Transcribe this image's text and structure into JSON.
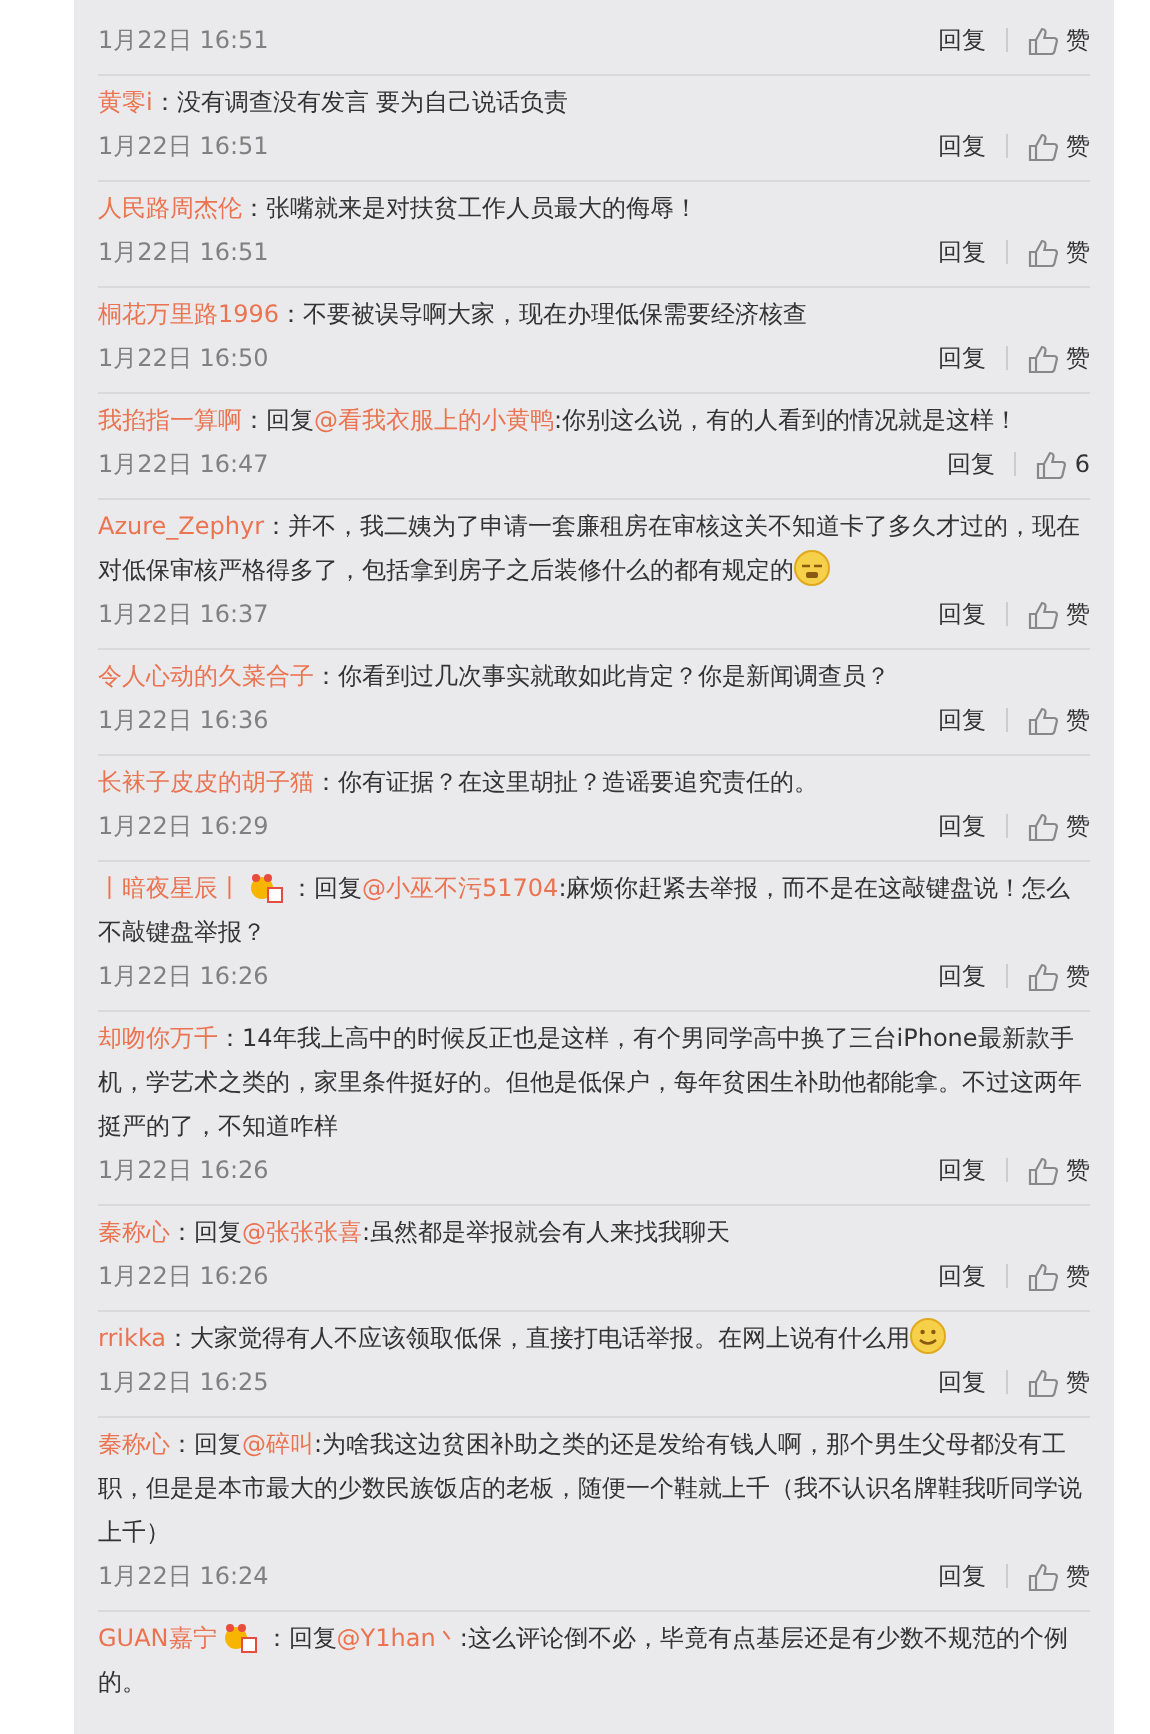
{
  "comments": [
    {
      "time": "1月22日 16:51",
      "reply_label": "回复",
      "like_label": "赞"
    },
    {
      "user": "黄零i",
      "text": "：没有调查没有发言 要为自己说话负责",
      "time": "1月22日 16:51",
      "reply_label": "回复",
      "like_label": "赞"
    },
    {
      "user": "人民路周杰伦",
      "text": "：张嘴就来是对扶贫工作人员最大的侮辱！",
      "time": "1月22日 16:51",
      "reply_label": "回复",
      "like_label": "赞"
    },
    {
      "user": "桐花万里路1996",
      "text": "：不要被误导啊大家，现在办理低保需要经济核查",
      "time": "1月22日 16:50",
      "reply_label": "回复",
      "like_label": "赞"
    },
    {
      "user": "我掐指一算啊",
      "prefix": "：回复",
      "mention": "@看我衣服上的小黄鸭",
      "text": ":你别这么说，有的人看到的情况就是这样！",
      "time": "1月22日 16:47",
      "reply_label": "回复",
      "like_label": "6"
    },
    {
      "user": "Azure_Zephyr",
      "text": "：并不，我二姨为了申请一套廉租房在审核这关不知道卡了多久才过的，现在对低保审核严格得多了，包括拿到房子之后装修什么的都有规定的",
      "emoji": {
        "kind": "awkward"
      },
      "time": "1月22日 16:37",
      "reply_label": "回复",
      "like_label": "赞"
    },
    {
      "user": "令人心动的久菜合子",
      "text": "：你看到过几次事实就敢如此肯定？你是新闻调查员？",
      "time": "1月22日 16:36",
      "reply_label": "回复",
      "like_label": "赞"
    },
    {
      "user": "长袜子皮皮的胡子猫",
      "text": "：你有证据？在这里胡扯？造谣要追究责任的。",
      "time": "1月22日 16:29",
      "reply_label": "回复",
      "like_label": "赞"
    },
    {
      "user": "丨暗夜星辰丨",
      "badge": true,
      "prefix": "：回复",
      "mention": "@小巫不污51704",
      "text": ":麻烦你赶紧去举报，而不是在这敲键盘说！怎么不敲键盘举报？",
      "time": "1月22日 16:26",
      "reply_label": "回复",
      "like_label": "赞"
    },
    {
      "user": "却吻你万千",
      "text": "：14年我上高中的时候反正也是这样，有个男同学高中换了三台iPhone最新款手机，学艺术之类的，家里条件挺好的。但他是低保户，每年贫困生补助他都能拿。不过这两年挺严的了，不知道咋样",
      "time": "1月22日 16:26",
      "reply_label": "回复",
      "like_label": "赞"
    },
    {
      "user": "秦称心",
      "prefix": "：回复",
      "mention": "@张张张喜",
      "text": ":虽然都是举报就会有人来找我聊天",
      "time": "1月22日 16:26",
      "reply_label": "回复",
      "like_label": "赞"
    },
    {
      "user": "rrikka",
      "text": "：大家觉得有人不应该领取低保，直接打电话举报。在网上说有什么用",
      "emoji": {
        "kind": "smile"
      },
      "time": "1月22日 16:25",
      "reply_label": "回复",
      "like_label": "赞"
    },
    {
      "user": "秦称心",
      "prefix": "：回复",
      "mention": "@碎叫",
      "text": ":为啥我这边贫困补助之类的还是发给有钱人啊，那个男生父母都没有工职，但是是本市最大的少数民族饭店的老板，随便一个鞋就上千（我不认识名牌鞋我听同学说上千）",
      "time": "1月22日 16:24",
      "reply_label": "回复",
      "like_label": "赞"
    },
    {
      "user": "GUAN嘉宁",
      "badge": true,
      "prefix": "：回复",
      "mention": "@Y1han丶",
      "text": ":这么评论倒不必，毕竟有点基层还是有少数不规范的个例的。"
    }
  ]
}
